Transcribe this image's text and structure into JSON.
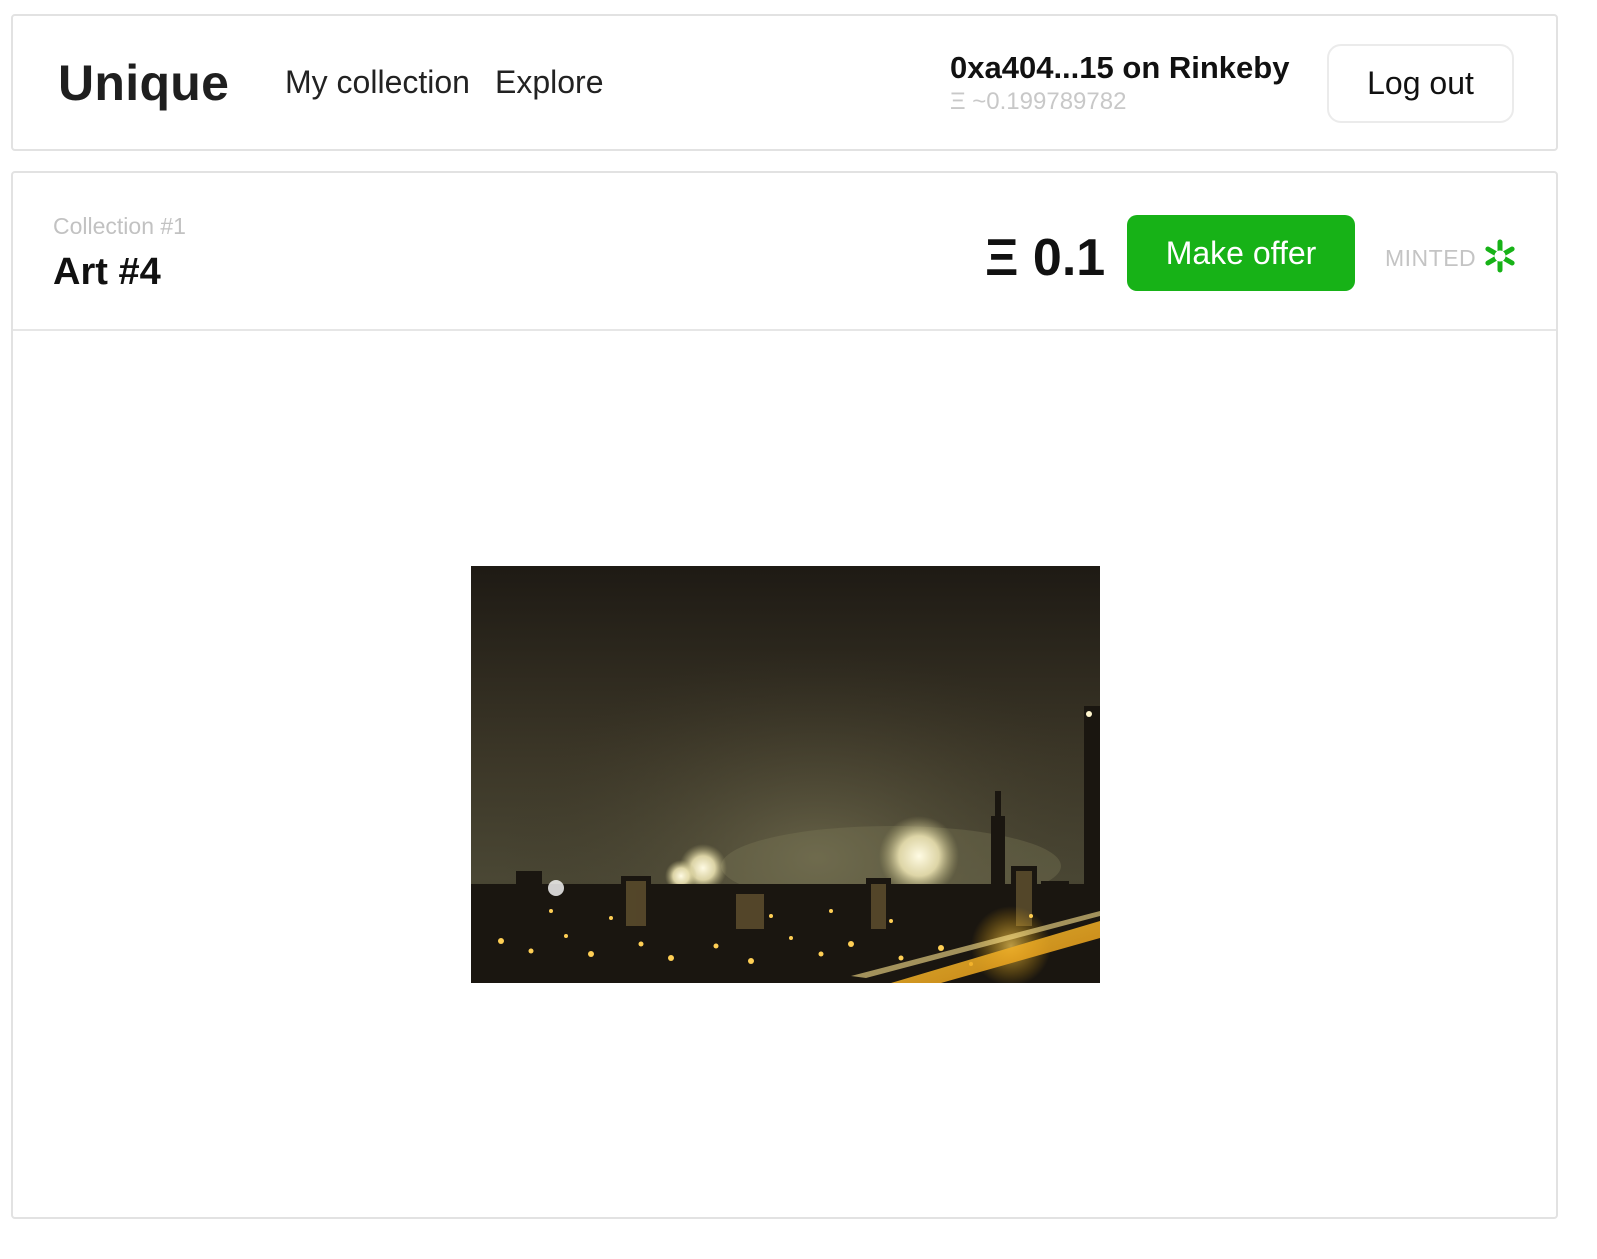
{
  "app": {
    "brand": "Unique",
    "nav": [
      {
        "label": "My collection"
      },
      {
        "label": "Explore"
      }
    ]
  },
  "account": {
    "name": "0xa404...15 on Rinkeby",
    "balance": "Ξ ~0.199789782",
    "logout_label": "Log out"
  },
  "artwork": {
    "collection_label": "Collection #1",
    "title": "Art #4",
    "price": "Ξ 0.1",
    "offer_label": "Make offer",
    "status": "MINTED",
    "status_icon": "asterisk-icon",
    "image_icon": "city-fireworks-image"
  },
  "colors": {
    "accent": "#17b217",
    "muted_text": "#c4c4c4",
    "border": "#e2e2e2"
  }
}
